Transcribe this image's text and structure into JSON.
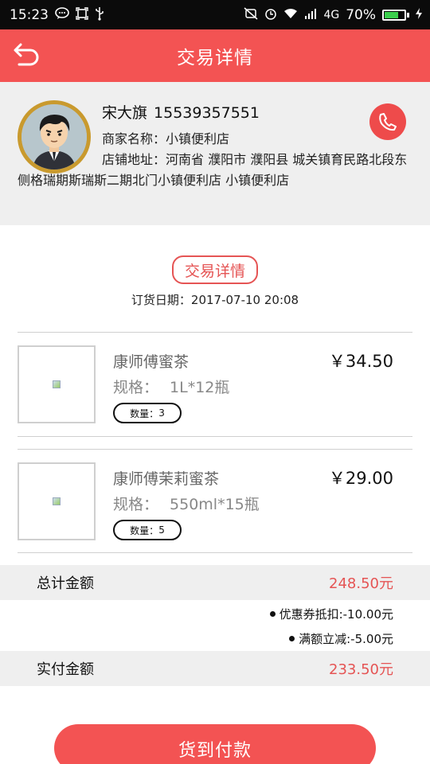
{
  "status_bar": {
    "time": "15:23",
    "network": "4G",
    "battery": "70%",
    "battery_level": 0.7,
    "icons_left": [
      "chat-icon",
      "screenshot-icon",
      "usb-icon"
    ],
    "icons_right": [
      "mute-icon",
      "alarm-icon",
      "wifi-icon",
      "signal-icon",
      "charging-icon"
    ]
  },
  "header": {
    "title": "交易详情",
    "back_icon": "back-arrow-icon"
  },
  "profile": {
    "name": "宋大旗",
    "phone": "15539357551",
    "merchant_label": "商家名称：",
    "merchant_name": "小镇便利店",
    "address_label": "店铺地址：",
    "address": "河南省 濮阳市 濮阳县 城关镇育民路北段东侧格瑞期斯瑞斯二期北门小镇便利店 小镇便利店",
    "call_icon": "phone-icon"
  },
  "order": {
    "section_title": "交易详情",
    "date_label": "订货日期：",
    "date": "2017-07-10 20:08"
  },
  "items": [
    {
      "name": "康师傅蜜茶",
      "spec_label": "规格：",
      "spec": "1L*12瓶",
      "qty_label": "数量：",
      "qty": "3",
      "price": "￥34.50"
    },
    {
      "name": "康师傅茉莉蜜茶",
      "spec_label": "规格：",
      "spec": "550ml*15瓶",
      "qty_label": "数量：",
      "qty": "5",
      "price": "￥29.00"
    }
  ],
  "summary": {
    "total_label": "总计金额",
    "total_value": "248.50元",
    "coupon": "优惠券抵扣:-10.00元",
    "reduction": "满额立减:-5.00元",
    "paid_label": "实付金额",
    "paid_value": "233.50元"
  },
  "action": {
    "pay_label": "货到付款"
  },
  "colors": {
    "accent": "#f35353",
    "price_red": "#e55454",
    "battery_green": "#3ccf4e"
  }
}
